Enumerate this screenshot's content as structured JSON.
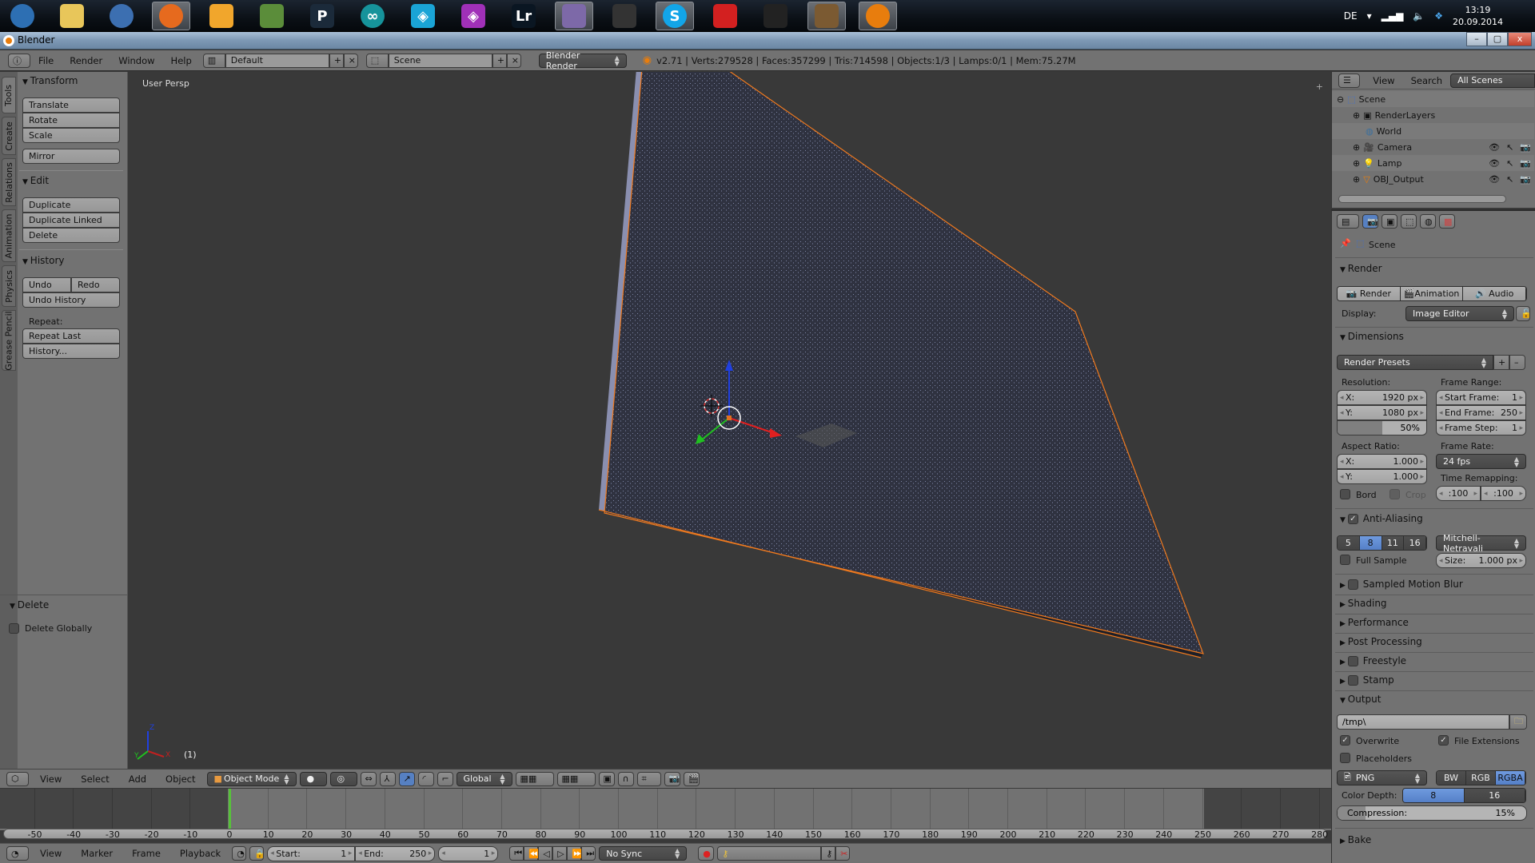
{
  "taskbar": {
    "apps": [
      {
        "name": "start-orb",
        "label": "",
        "color": "#2d6fb3",
        "active": false
      },
      {
        "name": "explorer",
        "label": "",
        "color": "#e8c65a",
        "active": false
      },
      {
        "name": "thunderbird",
        "label": "",
        "color": "#3c6fb1",
        "active": false
      },
      {
        "name": "firefox",
        "label": "",
        "color": "#e66a1e",
        "active": true
      },
      {
        "name": "photo-app",
        "label": "",
        "color": "#f1a62c",
        "active": false
      },
      {
        "name": "minecraft",
        "label": "",
        "color": "#5b8d3a",
        "active": false
      },
      {
        "name": "p-app",
        "label": "P",
        "color": "#1b2a3a",
        "active": false
      },
      {
        "name": "arduino",
        "label": "∞",
        "color": "#16939b",
        "active": false
      },
      {
        "name": "app-cyan",
        "label": "◈",
        "color": "#1aa4d6",
        "active": false
      },
      {
        "name": "app-purple",
        "label": "◈",
        "color": "#a030b8",
        "active": false
      },
      {
        "name": "lightroom",
        "label": "Lr",
        "color": "#0a1622",
        "active": false
      },
      {
        "name": "pidgin",
        "label": "",
        "color": "#7d69a8",
        "active": true
      },
      {
        "name": "teamspeak",
        "label": "",
        "color": "#333",
        "active": false
      },
      {
        "name": "skype",
        "label": "S",
        "color": "#12a5e8",
        "active": true
      },
      {
        "name": "app-red",
        "label": "",
        "color": "#d32020",
        "active": false
      },
      {
        "name": "inkscape",
        "label": "",
        "color": "#222",
        "active": false
      },
      {
        "name": "crafting",
        "label": "",
        "color": "#7b5a32",
        "active": true
      },
      {
        "name": "blender",
        "label": "",
        "color": "#e87d0d",
        "active": true
      }
    ],
    "language": "DE",
    "time": "13:19",
    "date": "20.09.2014"
  },
  "window": {
    "title": "Blender"
  },
  "infobar": {
    "menus": [
      "File",
      "Render",
      "Window",
      "Help"
    ],
    "layout": "Default",
    "scene": "Scene",
    "engine": "Blender Render",
    "stats": "v2.71 | Verts:279528 | Faces:357299 | Tris:714598 | Objects:1/3 | Lamps:0/1 | Mem:75.27M"
  },
  "toolshelf": {
    "tabs": [
      "Tools",
      "Create",
      "Relations",
      "Animation",
      "Physics",
      "Grease Pencil"
    ],
    "transform": {
      "title": "Transform",
      "buttons": [
        "Translate",
        "Rotate",
        "Scale"
      ],
      "mirror": "Mirror"
    },
    "edit": {
      "title": "Edit",
      "buttons": [
        "Duplicate",
        "Duplicate Linked",
        "Delete"
      ]
    },
    "history": {
      "title": "History",
      "undo": "Undo",
      "redo": "Redo",
      "undo_history": "Undo History",
      "repeat_label": "Repeat:",
      "repeat_last": "Repeat Last",
      "history": "History..."
    },
    "operator": {
      "title": "Delete",
      "option": "Delete Globally",
      "checked": false
    }
  },
  "viewport": {
    "label": "User Persp",
    "frame": "(1)",
    "axes": {
      "x": "X",
      "y": "Y",
      "z": "Z"
    }
  },
  "view3d_header": {
    "menus": [
      "View",
      "Select",
      "Add",
      "Object"
    ],
    "mode": "Object Mode",
    "orientation": "Global"
  },
  "timeline": {
    "ticks": [
      -50,
      -40,
      -30,
      -20,
      -10,
      0,
      10,
      20,
      30,
      40,
      50,
      60,
      70,
      80,
      90,
      100,
      110,
      120,
      130,
      140,
      150,
      160,
      170,
      180,
      190,
      200,
      210,
      220,
      230,
      240,
      250,
      260,
      270,
      280
    ],
    "current_frame": 1,
    "menus": [
      "View",
      "Marker",
      "Frame",
      "Playback"
    ],
    "start_label": "Start:",
    "start": "1",
    "end_label": "End:",
    "end": "250",
    "frame": "1",
    "sync": "No Sync"
  },
  "outliner": {
    "menus": [
      "View",
      "Search"
    ],
    "filter": "All Scenes",
    "items": [
      {
        "label": "Scene",
        "indent": 0
      },
      {
        "label": "RenderLayers",
        "indent": 1
      },
      {
        "label": "World",
        "indent": 1
      },
      {
        "label": "Camera",
        "indent": 1
      },
      {
        "label": "Lamp",
        "indent": 1
      },
      {
        "label": "OBJ_Output",
        "indent": 1
      }
    ]
  },
  "properties": {
    "context": "Scene",
    "render": {
      "title": "Render",
      "render_btn": "Render",
      "animation_btn": "Animation",
      "audio_btn": "Audio",
      "display_label": "Display:",
      "display": "Image Editor"
    },
    "dimensions": {
      "title": "Dimensions",
      "presets": "Render Presets",
      "resolution_label": "Resolution:",
      "res_x_label": "X:",
      "res_x": "1920 px",
      "res_y_label": "Y:",
      "res_y": "1080 px",
      "res_pct": "50%",
      "res_pct_value": 0.5,
      "frame_range_label": "Frame Range:",
      "start_label": "Start Frame:",
      "start": "1",
      "end_label": "End Frame:",
      "end": "250",
      "step_label": "Frame Step:",
      "step": "1",
      "aspect_label": "Aspect Ratio:",
      "asp_x_label": "X:",
      "asp_x": "1.000",
      "asp_y_label": "Y:",
      "asp_y": "1.000",
      "frame_rate_label": "Frame Rate:",
      "frame_rate": "24 fps",
      "border": "Bord",
      "crop": "Crop",
      "time_remap_label": "Time Remapping:",
      "remap_old": ":100",
      "remap_new": ":100"
    },
    "aa": {
      "title": "Anti-Aliasing",
      "enabled": true,
      "samples": [
        "5",
        "8",
        "11",
        "16"
      ],
      "selected": "8",
      "filter": "Mitchell-Netravali",
      "full_sample": "Full Sample",
      "size_label": "Size:",
      "size": "1.000 px"
    },
    "collapsed": [
      {
        "title": "Sampled Motion Blur",
        "checkbox": true
      },
      {
        "title": "Shading",
        "checkbox": false
      },
      {
        "title": "Performance",
        "checkbox": false
      },
      {
        "title": "Post Processing",
        "checkbox": false
      },
      {
        "title": "Freestyle",
        "checkbox": true
      },
      {
        "title": "Stamp",
        "checkbox": true
      }
    ],
    "output": {
      "title": "Output",
      "path": "/tmp\\",
      "overwrite": "Overwrite",
      "file_ext": "File Extensions",
      "placeholders": "Placeholders",
      "format": "PNG",
      "color_modes": [
        "BW",
        "RGB",
        "RGBA"
      ],
      "color_mode": "RGBA",
      "depth_label": "Color Depth:",
      "depths": [
        "8",
        "16"
      ],
      "depth": "8",
      "compression_label": "Compression:",
      "compression": "15%",
      "compression_value": 0.15
    },
    "bake": {
      "title": "Bake"
    }
  }
}
